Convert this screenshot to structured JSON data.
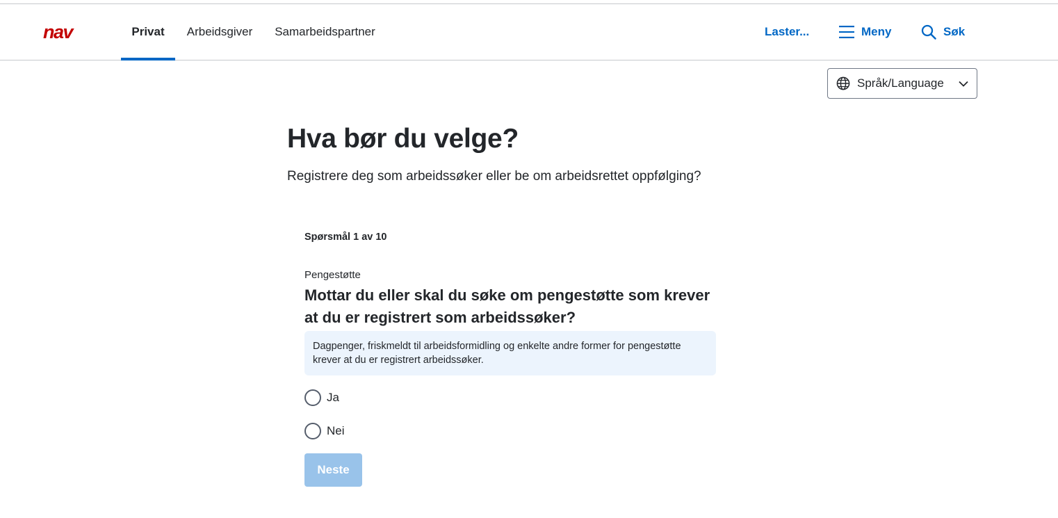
{
  "header": {
    "logo_text": "nav",
    "tabs": [
      {
        "label": "Privat",
        "active": true
      },
      {
        "label": "Arbeidsgiver",
        "active": false
      },
      {
        "label": "Samarbeidspartner",
        "active": false
      }
    ],
    "loading_label": "Laster...",
    "menu_label": "Meny",
    "search_label": "Søk"
  },
  "language": {
    "label": "Språk/Language"
  },
  "page": {
    "title": "Hva bør du velge?",
    "subtitle": "Registrere deg som arbeidssøker eller be om arbeidsrettet oppfølging?"
  },
  "question": {
    "counter": "Spørsmål 1 av 10",
    "category": "Pengestøtte",
    "text": "Mottar du eller skal du søke om pengestøtte som krever at du er registrert som arbeidssøker?",
    "info": "Dagpenger, friskmeldt til arbeidsformidling og enkelte andre former for pengestøtte krever at du er registrert arbeidssøker.",
    "options": [
      {
        "label": "Ja"
      },
      {
        "label": "Nei"
      }
    ],
    "next_label": "Neste"
  },
  "colors": {
    "brand_red": "#c30000",
    "accent_blue": "#0067c5",
    "info_bg": "#ecf4fd",
    "disabled_button": "#99c3ea"
  }
}
